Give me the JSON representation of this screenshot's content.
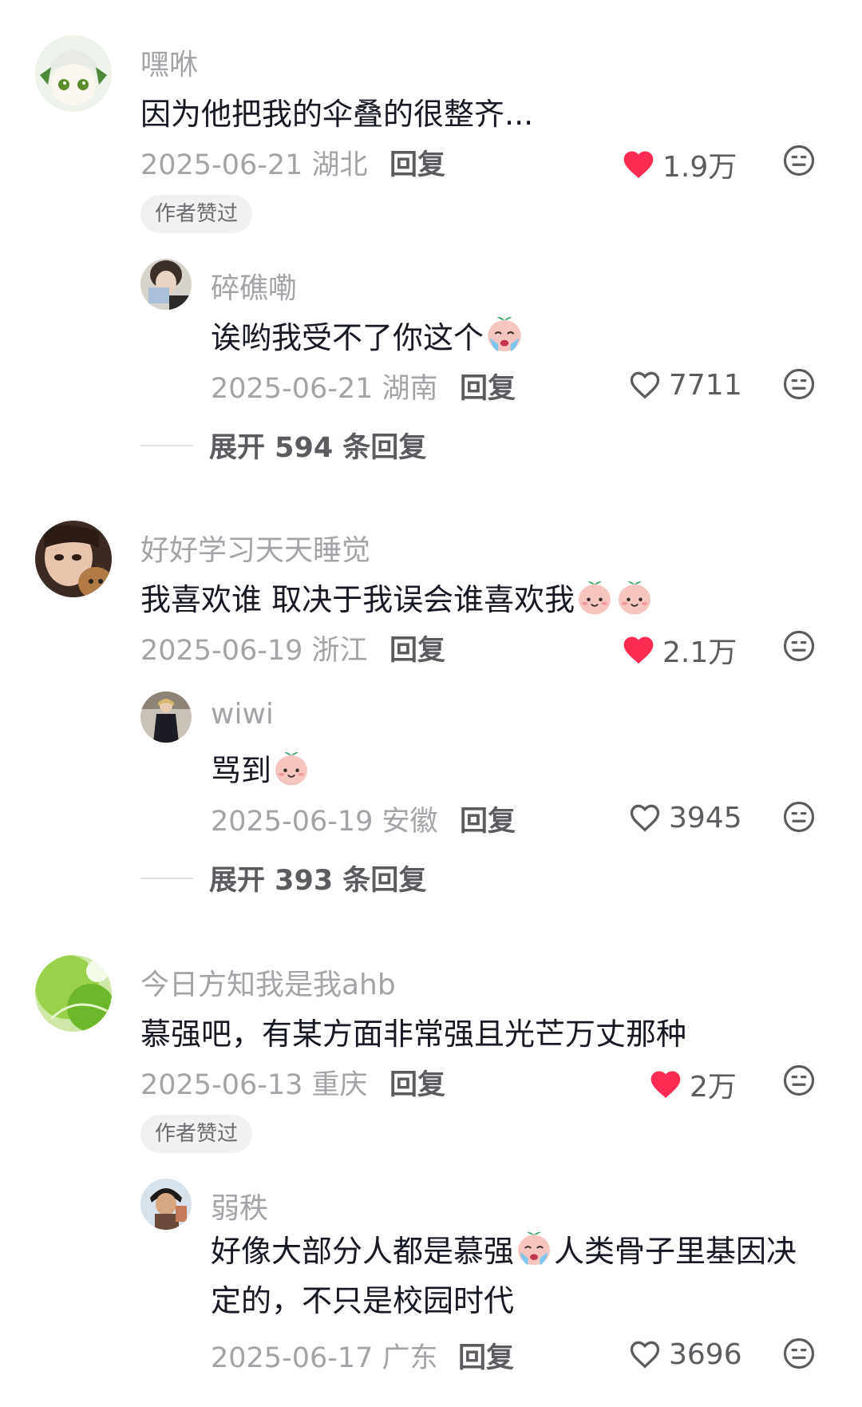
{
  "comments": [
    {
      "user": "嘿咻",
      "text": "因为他把我的伞叠的很整齐...",
      "date": "2025-06-21",
      "location": "湖北",
      "reply_label": "回复",
      "likes": "1.9万",
      "liked": true,
      "author_liked_badge": "作者赞过",
      "reply": {
        "user": "碎礁嘞",
        "text": "诶哟我受不了你这个",
        "emoji": [
          "crying-emoji"
        ],
        "date": "2025-06-21",
        "location": "湖南",
        "reply_label": "回复",
        "likes": "7711"
      },
      "expand_text": "展开 594 条回复"
    },
    {
      "user": "好好学习天天睡觉",
      "text": "我喜欢谁 取决于我误会谁喜欢我",
      "emoji": [
        "peach-face-emoji",
        "peach-face-emoji"
      ],
      "date": "2025-06-19",
      "location": "浙江",
      "reply_label": "回复",
      "likes": "2.1万",
      "liked": true,
      "reply": {
        "user": "wiwi",
        "text": "骂到",
        "emoji": [
          "peach-face-emoji"
        ],
        "date": "2025-06-19",
        "location": "安徽",
        "reply_label": "回复",
        "likes": "3945"
      },
      "expand_text": "展开 393 条回复"
    },
    {
      "user": "今日方知我是我ahb",
      "text": "慕强吧，有某方面非常强且光芒万丈那种",
      "date": "2025-06-13",
      "location": "重庆",
      "reply_label": "回复",
      "likes": "2万",
      "liked": true,
      "author_liked_badge": "作者赞过",
      "reply": {
        "user": "弱秩",
        "text_part1": "好像大部分人都是慕强",
        "emoji": [
          "crying-peach-emoji"
        ],
        "text_part2": "人类骨子里基因决定的，不只是校园时代",
        "date": "2025-06-17",
        "location": "广东",
        "reply_label": "回复",
        "likes": "3696"
      }
    }
  ],
  "colors": {
    "like_active": "#fe2c55",
    "text_primary": "#161823",
    "text_secondary": "#a3a3a8"
  }
}
